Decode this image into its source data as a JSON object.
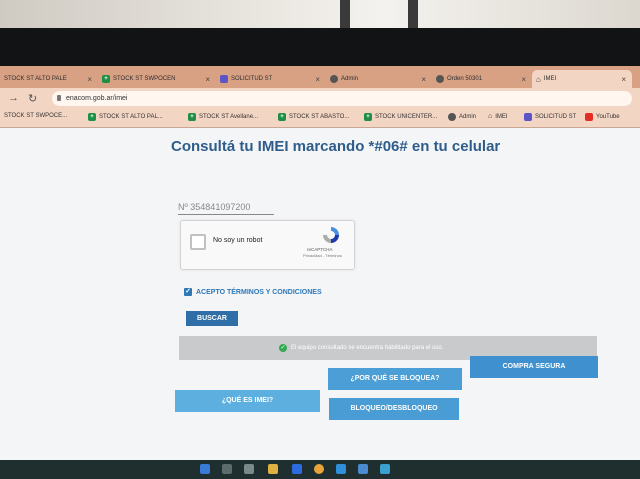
{
  "browser": {
    "tabs": [
      {
        "label": "STOCK ST ALTO PALE",
        "icon": "sheets-icon"
      },
      {
        "label": "STOCK ST SWPOCEN",
        "icon": "sheets-icon"
      },
      {
        "label": "SOLICITUD ST",
        "icon": "forms-icon"
      },
      {
        "label": "Admin",
        "icon": "globe-icon"
      },
      {
        "label": "Orden 50301",
        "icon": "globe-icon"
      },
      {
        "label": "IMEI",
        "icon": "enacom-icon"
      }
    ],
    "url": "enacom.gob.ar/imei",
    "bookmarks": [
      {
        "label": "STOCK ST SWPOCE...",
        "icon": "none"
      },
      {
        "label": "STOCK ST ALTO PAL...",
        "icon": "sheets-icon"
      },
      {
        "label": "STOCK ST Avellane...",
        "icon": "sheets-icon"
      },
      {
        "label": "STOCK ST ABASTO...",
        "icon": "sheets-icon"
      },
      {
        "label": "STOCK UNICENTER...",
        "icon": "sheets-icon"
      },
      {
        "label": "Admin",
        "icon": "globe-icon"
      },
      {
        "label": "IMEI",
        "icon": "enacom-icon"
      },
      {
        "label": "SOLICITUD ST",
        "icon": "forms-icon"
      },
      {
        "label": "YouTube",
        "icon": "youtube-icon"
      }
    ]
  },
  "page": {
    "title": "Consultá tu IMEI marcando *#06# en tu celular",
    "imei_value": "Nº 354841097200",
    "captcha": {
      "label": "No soy un robot",
      "brand": "reCAPTCHA",
      "links": "Privacidad - Términos"
    },
    "terms_label": "ACEPTO TÉRMINOS Y CONDICIONES",
    "search_button": "BUSCAR",
    "status_message": "El equipo consultado se encuentra habilitado para el uso.",
    "buttons": {
      "what_is_imei": "¿QUÉ ES IMEI?",
      "why_blocked": "¿POR QUÉ SE BLOQUEA?",
      "safe_purchase": "COMPRA SEGURA",
      "block_unblock": "BLOQUEO/DESBLOQUEO"
    }
  },
  "colors": {
    "title": "#2e5d8c",
    "tab_bar": "#d9a184",
    "button_primary": "#2f6ea7",
    "button_light": "#5dafe0",
    "status_ok": "#35a853"
  }
}
